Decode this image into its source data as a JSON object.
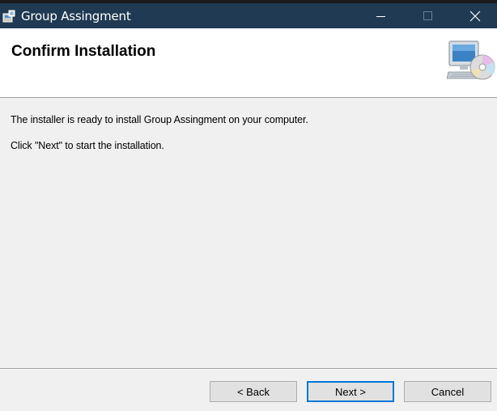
{
  "window": {
    "title": "Group Assingment"
  },
  "header": {
    "title": "Confirm Installation"
  },
  "content": {
    "line1": "The installer is ready to install Group Assingment on your computer.",
    "line2": "Click \"Next\" to start the installation."
  },
  "buttons": {
    "back": "< Back",
    "next": "Next >",
    "cancel": "Cancel"
  },
  "icons": {
    "app": "installer-package-icon",
    "minimize": "minimize-icon",
    "maximize": "maximize-icon",
    "close": "close-icon",
    "banner": "computer-cd-icon"
  },
  "colors": {
    "titlebar": "#1f3a52",
    "accent": "#0078d7",
    "background": "#f0f0f0"
  }
}
